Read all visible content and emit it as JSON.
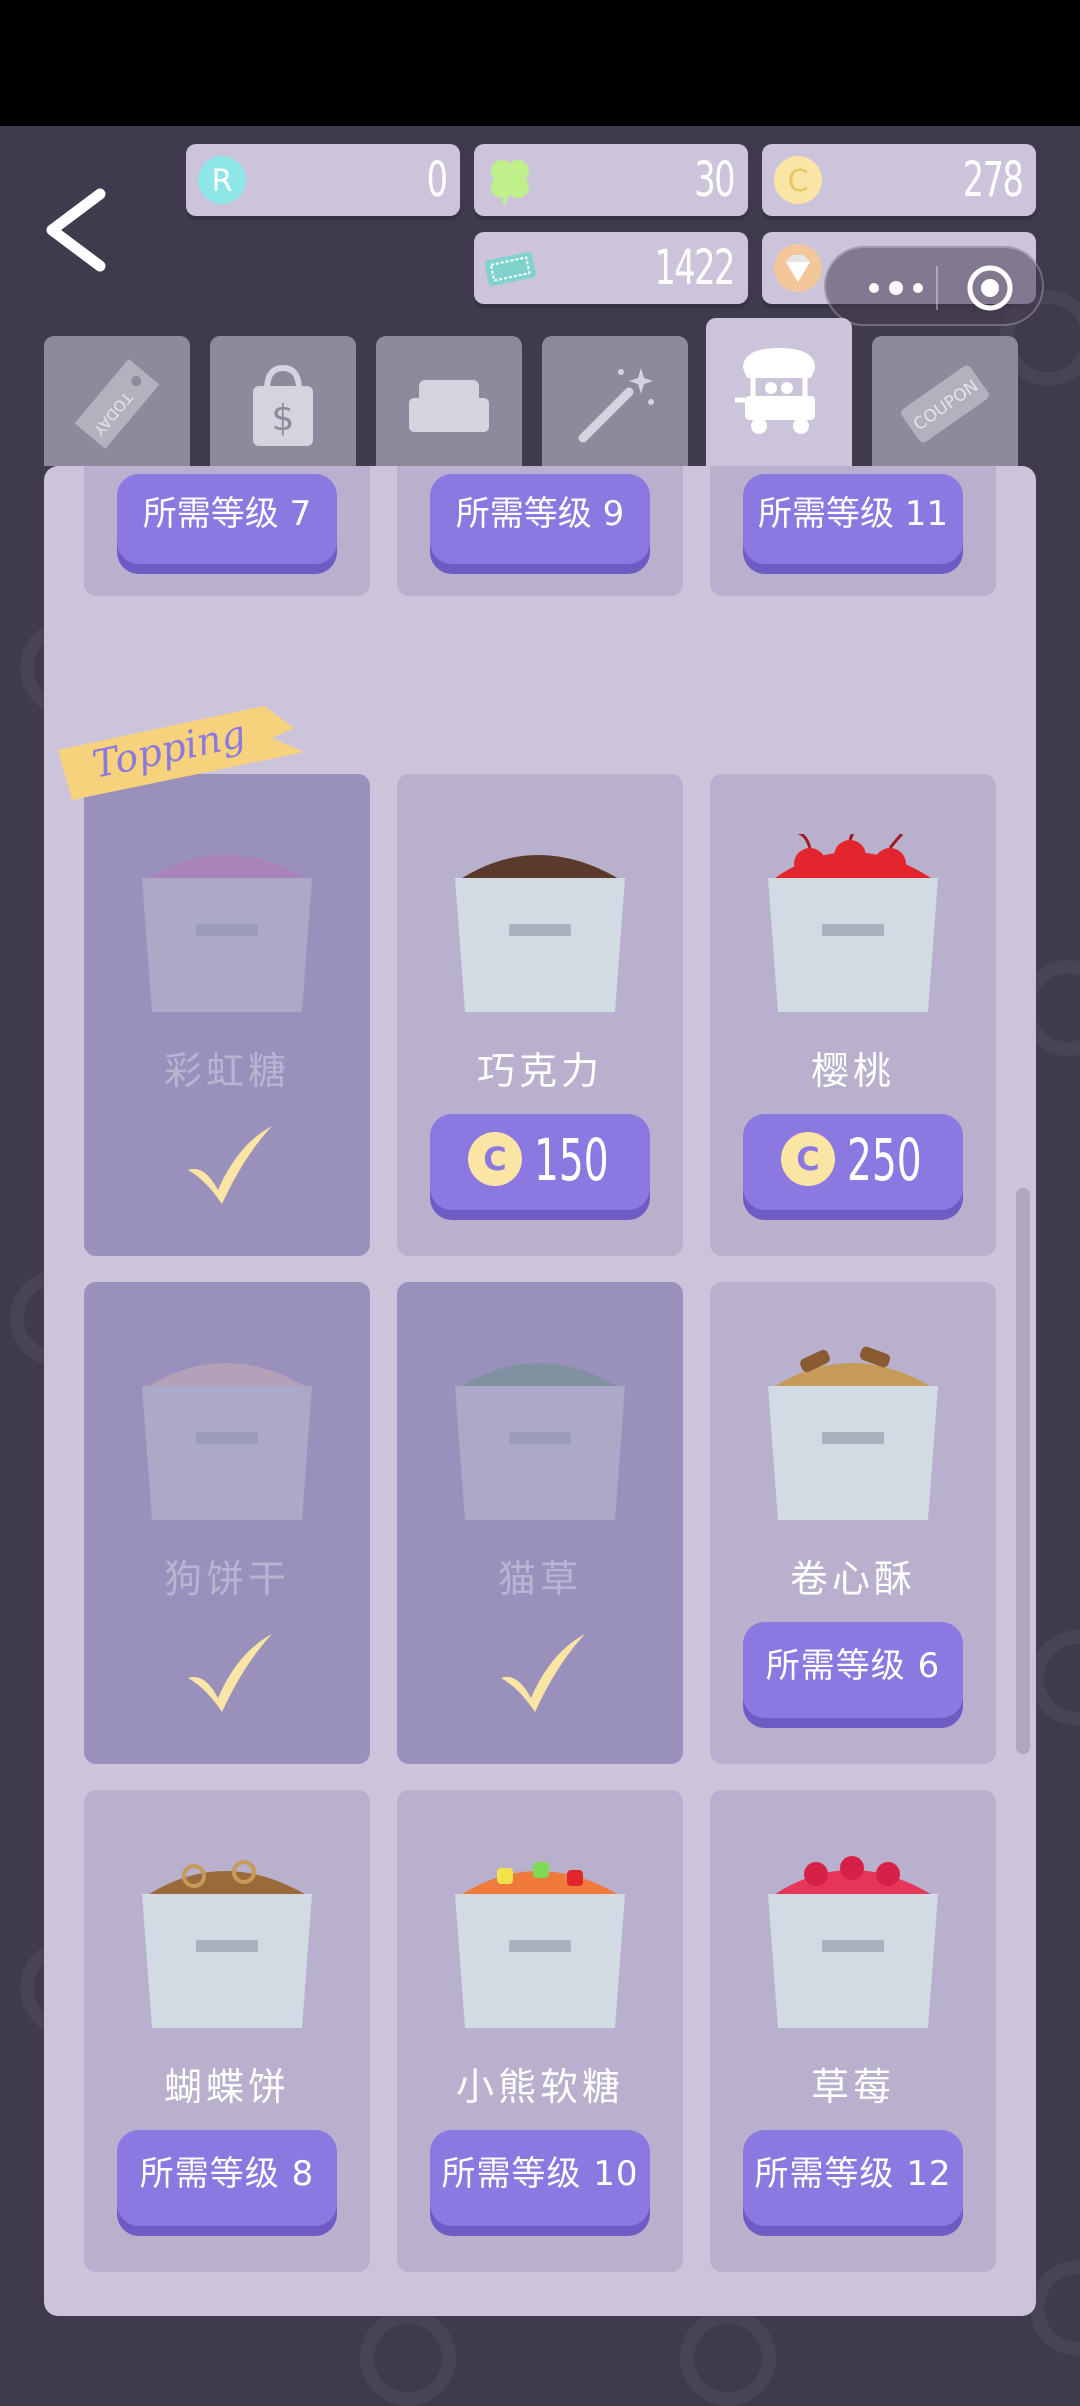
{
  "resources": {
    "r_value": "0",
    "clover_value": "30",
    "coin_value": "278",
    "ticket_value": "1422"
  },
  "tabs": [
    "today-tab",
    "shop-bag-tab",
    "sofa-tab",
    "magic-wand-tab",
    "ice-cream-cart-tab",
    "coupon-tab"
  ],
  "section_label": "Topping",
  "top_row": [
    {
      "level_label": "所需等级 7"
    },
    {
      "level_label": "所需等级 9"
    },
    {
      "level_label": "所需等级 11"
    }
  ],
  "items": [
    {
      "name": "彩虹糖",
      "state": "owned"
    },
    {
      "name": "巧克力",
      "state": "buy",
      "price": "150"
    },
    {
      "name": "樱桃",
      "state": "buy",
      "price": "250"
    },
    {
      "name": "狗饼干",
      "state": "owned"
    },
    {
      "name": "猫草",
      "state": "owned"
    },
    {
      "name": "卷心酥",
      "state": "locked",
      "level_label": "所需等级 6"
    },
    {
      "name": "蝴蝶饼",
      "state": "locked",
      "level_label": "所需等级 8"
    },
    {
      "name": "小熊软糖",
      "state": "locked",
      "level_label": "所需等级 10"
    },
    {
      "name": "草莓",
      "state": "locked",
      "level_label": "所需等级 12"
    }
  ],
  "coin_symbol": "C",
  "r_symbol": "R",
  "colors": {
    "accent": "#8b78e0",
    "panel": "#cbc4db",
    "coin": "#fbe5a4"
  }
}
